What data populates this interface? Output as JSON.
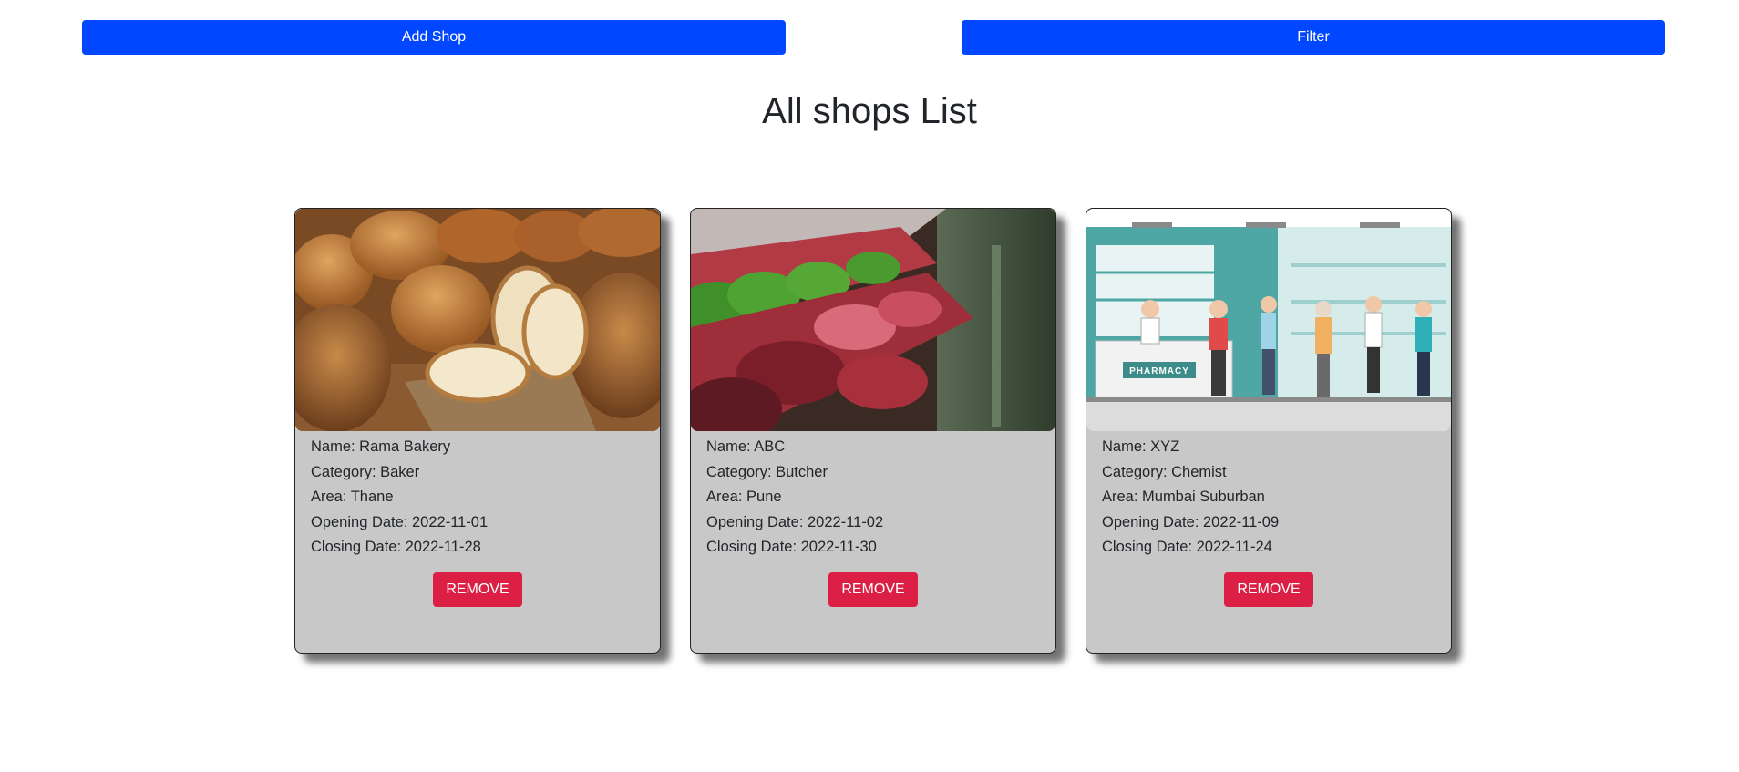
{
  "toolbar": {
    "add_label": "Add Shop",
    "filter_label": "Filter"
  },
  "page": {
    "title": "All shops List"
  },
  "colors": {
    "primary": "#0047ff",
    "danger": "#dc1f44",
    "card_bg": "#c8c8c8"
  },
  "shops": [
    {
      "image": "bakery-bread-photo",
      "name": "Name: Rama Bakery",
      "category": "Category: Baker",
      "area": "Area: Thane",
      "opening": "Opening Date: 2022-11-01",
      "closing": "Closing Date: 2022-11-28",
      "remove_label": "REMOVE"
    },
    {
      "image": "butcher-meat-photo",
      "name": "Name: ABC",
      "category": "Category: Butcher",
      "area": "Area: Pune",
      "opening": "Opening Date: 2022-11-02",
      "closing": "Closing Date: 2022-11-30",
      "remove_label": "REMOVE"
    },
    {
      "image": "pharmacy-illustration",
      "image_sign": "PHARMACY",
      "name": "Name: XYZ",
      "category": "Category: Chemist",
      "area": "Area: Mumbai Suburban",
      "opening": "Opening Date: 2022-11-09",
      "closing": "Closing Date: 2022-11-24",
      "remove_label": "REMOVE"
    }
  ]
}
